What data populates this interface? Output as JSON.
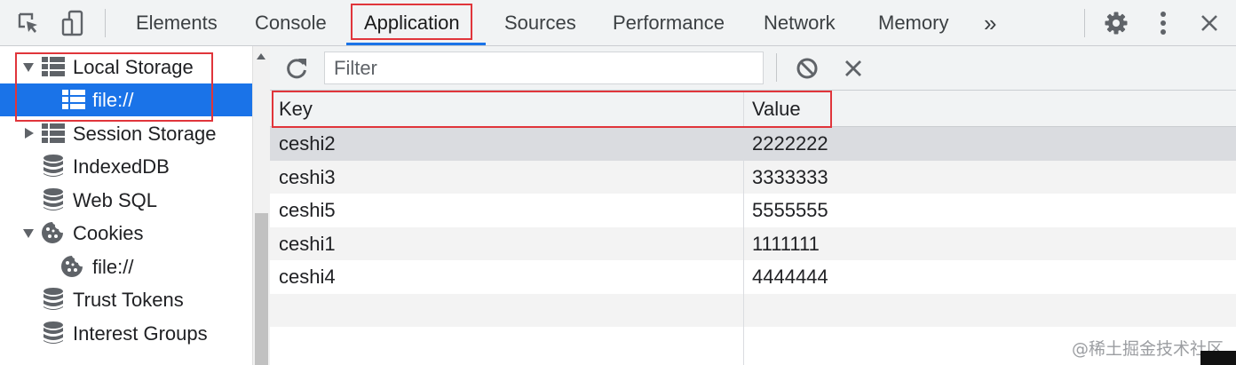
{
  "toolbar": {
    "tabs": [
      {
        "label": "Elements"
      },
      {
        "label": "Console"
      },
      {
        "label": "Application"
      },
      {
        "label": "Sources"
      },
      {
        "label": "Performance"
      },
      {
        "label": "Network"
      },
      {
        "label": "Memory"
      }
    ],
    "more_label": "»",
    "active_tab": "Application"
  },
  "sidebar": {
    "items": [
      {
        "label": "Local Storage",
        "icon": "table-grid-icon",
        "expanded": true
      },
      {
        "label": "file://",
        "icon": "table-grid-icon",
        "selected": true
      },
      {
        "label": "Session Storage",
        "icon": "table-grid-icon",
        "expanded": false
      },
      {
        "label": "IndexedDB",
        "icon": "database-icon"
      },
      {
        "label": "Web SQL",
        "icon": "database-icon"
      },
      {
        "label": "Cookies",
        "icon": "cookie-icon",
        "expanded": true
      },
      {
        "label": "file://",
        "icon": "cookie-icon"
      },
      {
        "label": "Trust Tokens",
        "icon": "database-icon"
      },
      {
        "label": "Interest Groups",
        "icon": "database-icon"
      }
    ]
  },
  "filter": {
    "placeholder": "Filter",
    "value": ""
  },
  "table": {
    "columns": [
      "Key",
      "Value"
    ],
    "rows": [
      {
        "key": "ceshi2",
        "value": "2222222"
      },
      {
        "key": "ceshi3",
        "value": "3333333"
      },
      {
        "key": "ceshi5",
        "value": "5555555"
      },
      {
        "key": "ceshi1",
        "value": "1111111"
      },
      {
        "key": "ceshi4",
        "value": "4444444"
      }
    ]
  },
  "watermark": "@稀土掘金技术社区",
  "colors": {
    "accent": "#1a73e8",
    "highlight_box": "#e0353b",
    "toolbar_bg": "#f1f3f4"
  }
}
